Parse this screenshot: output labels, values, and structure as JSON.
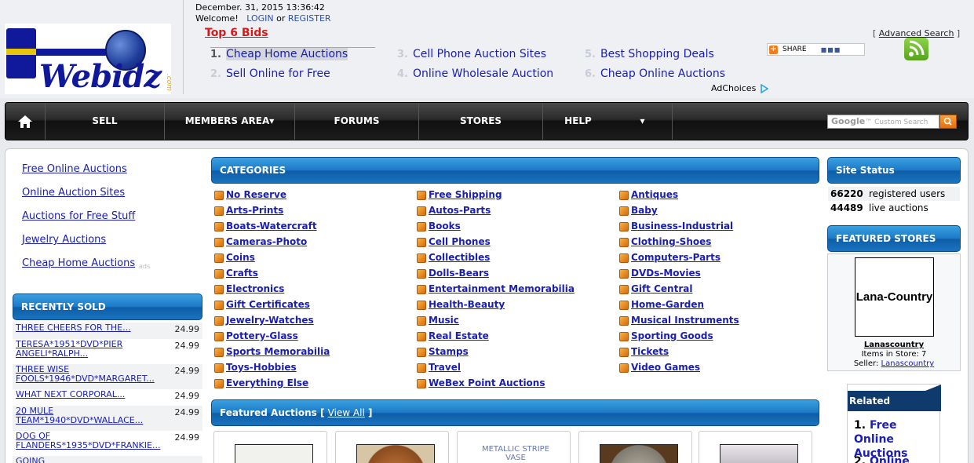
{
  "header": {
    "datetime": "December. 31, 2015 13:36:42",
    "welcome_label": "Welcome!",
    "login_label": "LOGIN",
    "or_label": "or",
    "register_label": "REGISTER",
    "logo_text": "Webidz",
    "logo_suffix": ".com",
    "top_bids_title": "Top 6 Bids",
    "top_bids": [
      {
        "num": "1.",
        "label": "Cheap Home Auctions"
      },
      {
        "num": "2.",
        "label": "Sell Online for Free"
      },
      {
        "num": "3.",
        "label": "Cell Phone Auction Sites"
      },
      {
        "num": "4.",
        "label": "Online Wholesale Auction"
      },
      {
        "num": "5.",
        "label": "Best Shopping Deals"
      },
      {
        "num": "6.",
        "label": "Cheap Online Auctions"
      }
    ],
    "adchoices_label": "AdChoices",
    "advanced_search_label": "Advanced Search",
    "share_label": "SHARE"
  },
  "nav": {
    "items": [
      "SELL",
      "MEMBERS AREA",
      "FORUMS",
      "STORES",
      "HELP"
    ],
    "search_placeholder": "Custom Search",
    "search_brand": "Google"
  },
  "left": {
    "links": [
      "Free Online Auctions",
      "Online Auction Sites",
      "Auctions for Free Stuff",
      "Jewelry Auctions",
      "Cheap Home Auctions"
    ],
    "ads_label": "ads",
    "recently_sold_title": "RECENTLY SOLD",
    "recently_sold": [
      {
        "title": "THREE CHEERS FOR THE...",
        "price": "24.99"
      },
      {
        "title": "TERESA*1951*DVD*PIER ANGELI*RALPH...",
        "price": "24.99"
      },
      {
        "title": "THREE WISE FOOLS*1946*DVD*MARGARET...",
        "price": "24.99"
      },
      {
        "title": "WHAT NEXT CORPORAL...",
        "price": "24.99"
      },
      {
        "title": "20 MULE TEAM*1940*DVD*WALLACE...",
        "price": "24.99"
      },
      {
        "title": "DOG OF FLANDERS*1935*DVD*FRANKIE...",
        "price": "24.99"
      },
      {
        "title": "GOING",
        "price": ""
      }
    ]
  },
  "categories": {
    "title": "CATEGORIES",
    "col1": [
      "No Reserve",
      "Arts-Prints",
      "Boats-Watercraft",
      "Cameras-Photo",
      "Coins",
      "Crafts",
      "Electronics",
      "Gift Certificates",
      "Jewelry-Watches",
      "Pottery-Glass",
      "Sports Memorabilia",
      "Toys-Hobbies",
      "Everything Else"
    ],
    "col2": [
      "Free Shipping",
      "Autos-Parts",
      "Books",
      "Cell Phones",
      "Collectibles",
      "Dolls-Bears",
      "Entertainment Memorabilia",
      "Health-Beauty",
      "Music",
      "Real Estate",
      "Stamps",
      "Travel",
      "WeBex Point Auctions"
    ],
    "col3": [
      "Antiques",
      "Baby",
      "Business-Industrial",
      "Clothing-Shoes",
      "Computers-Parts",
      "DVDs-Movies",
      "Gift Central",
      "Home-Garden",
      "Musical Instruments",
      "Sporting Goods",
      "Tickets",
      "Video Games"
    ]
  },
  "featured_auctions": {
    "title": "Featured Auctions",
    "view_all_label": "View All",
    "thumb_alt": "METALLIC STRIPE VASE"
  },
  "site_status": {
    "title": "Site Status",
    "rows": [
      {
        "value": "66220",
        "label": "registered users"
      },
      {
        "value": "44489",
        "label": "live auctions"
      }
    ]
  },
  "featured_stores": {
    "title": "FEATURED STORES",
    "store_logo_text": "Lana-Country",
    "store_name": "Lanascountry",
    "items_label": "Items in Store: 7",
    "seller_label": "Seller:",
    "seller_name": "Lanascountry"
  },
  "related_searches": {
    "title": "Related Searches",
    "items": [
      {
        "num": "1.",
        "label": "Free Online Auctions"
      },
      {
        "num": "2.",
        "label": "Online"
      }
    ]
  },
  "colors": {
    "link_blue": "#1b20b3",
    "bar_blue": "#1b78c6",
    "top_bids_red": "#d61a1a"
  }
}
